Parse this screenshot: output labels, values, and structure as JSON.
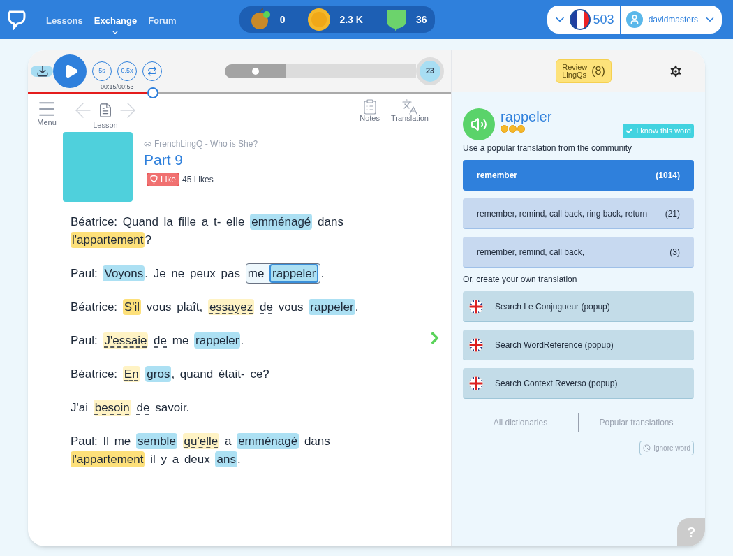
{
  "nav": {
    "items": [
      {
        "label": "Lessons",
        "selected": false
      },
      {
        "label": "Exchange",
        "selected": true
      },
      {
        "label": "Forum",
        "selected": false
      }
    ]
  },
  "stats": [
    {
      "kind": "apple",
      "value": "0"
    },
    {
      "kind": "coin",
      "value": "2.3 K"
    },
    {
      "kind": "lingq",
      "value": "36"
    }
  ],
  "language": {
    "count": "503"
  },
  "user": {
    "name": "davidmasters"
  },
  "player": {
    "download_on": true,
    "rewind": "5s",
    "speed": "0.5x",
    "time": "00:15/00:53",
    "level": 0.295
  },
  "lesson_progress": {
    "level": 0.32,
    "badge": "23"
  },
  "review": {
    "label": "Review LingQs",
    "count": "(8)"
  },
  "toolbar": [
    {
      "kind": "menu",
      "label": "Menu"
    },
    {
      "kind": "lesson",
      "label": "Lesson"
    },
    {
      "kind": "notes",
      "label": "Notes"
    },
    {
      "kind": "translation",
      "label": "Translation"
    }
  ],
  "lesson": {
    "course": "FrenchLingQ - Who is She?",
    "title": "Part 9",
    "like": "Like",
    "likes": "45 Likes",
    "paragraphs": [
      [
        {
          "kind": "plain",
          "text": "Béatrice: Quand la fille a t- elle "
        },
        {
          "kind": "new",
          "text": "emménagé"
        },
        {
          "kind": "plain",
          "text": " dans "
        },
        {
          "kind": "lingq",
          "text": "l'appartement"
        },
        {
          "kind": "plain",
          "text": "?"
        }
      ],
      [
        {
          "kind": "plain",
          "text": "Paul: "
        },
        {
          "kind": "new",
          "text": "Voyons"
        },
        {
          "kind": "plain",
          "text": ". Je ne peux pas "
        },
        {
          "kind": "phrase",
          "parts": [
            {
              "kind": "plain",
              "text": "me "
            },
            {
              "kind": "selected",
              "text": "rappeler"
            }
          ]
        },
        {
          "kind": "plain",
          "text": "."
        }
      ],
      [
        {
          "kind": "plain",
          "text": "Béatrice: "
        },
        {
          "kind": "lingq",
          "text": "S'il"
        },
        {
          "kind": "plain",
          "text": " vous plaît, "
        },
        {
          "kind": "learning",
          "text": "essayez",
          "space_after": true
        },
        {
          "kind": "marked",
          "text": "de"
        },
        {
          "kind": "plain",
          "text": " vous "
        },
        {
          "kind": "new",
          "text": "rappeler"
        },
        {
          "kind": "plain",
          "text": "."
        }
      ],
      [
        {
          "kind": "plain",
          "text": "Paul: "
        },
        {
          "kind": "learning",
          "text": "J'essaie",
          "space_after": true
        },
        {
          "kind": "marked",
          "text": "de"
        },
        {
          "kind": "plain",
          "text": " me "
        },
        {
          "kind": "new",
          "text": "rappeler"
        },
        {
          "kind": "plain",
          "text": "."
        }
      ],
      [
        {
          "kind": "plain",
          "text": "Béatrice: "
        },
        {
          "kind": "learning",
          "text": "En",
          "space_after": true
        },
        {
          "kind": "new",
          "text": "gros"
        },
        {
          "kind": "plain",
          "text": ", quand était- ce?"
        }
      ],
      [
        {
          "kind": "plain",
          "text": "J'ai "
        },
        {
          "kind": "learning",
          "text": "besoin",
          "space_after": true
        },
        {
          "kind": "marked",
          "text": "de"
        },
        {
          "kind": "plain",
          "text": " savoir."
        }
      ],
      [
        {
          "kind": "plain",
          "text": "Paul: Il me "
        },
        {
          "kind": "new",
          "text": "semble",
          "space_after": true
        },
        {
          "kind": "learning",
          "text": "qu'elle"
        },
        {
          "kind": "plain",
          "text": " a "
        },
        {
          "kind": "new",
          "text": "emménagé"
        },
        {
          "kind": "plain",
          "text": " dans "
        },
        {
          "kind": "lingq",
          "text": "l'appartement"
        },
        {
          "kind": "plain",
          "text": " il y a deux "
        },
        {
          "kind": "new",
          "text": "ans"
        },
        {
          "kind": "plain",
          "text": "."
        }
      ]
    ]
  },
  "word": {
    "term": "rappeler",
    "stars": 3,
    "know_label": "I know this word",
    "hint": "Use a popular translation from the community",
    "translations": [
      {
        "text": "remember",
        "count": "(1014)",
        "selected": true
      },
      {
        "text": "remember, remind, call back, ring back, return",
        "count": "(21)",
        "selected": false
      },
      {
        "text": "remember, remind, call back,",
        "count": "(3)",
        "selected": false
      }
    ],
    "own_label": "Or, create your own translation",
    "dictionaries": [
      "Search Le Conjugueur (popup)",
      "Search WordReference (popup)",
      "Search Context Reverso (popup)"
    ],
    "tabs": [
      {
        "label": "All dictionaries",
        "selected": false
      },
      {
        "label": "Popular translations",
        "selected": false
      }
    ],
    "ignore": "Ignore word"
  },
  "help": "?"
}
